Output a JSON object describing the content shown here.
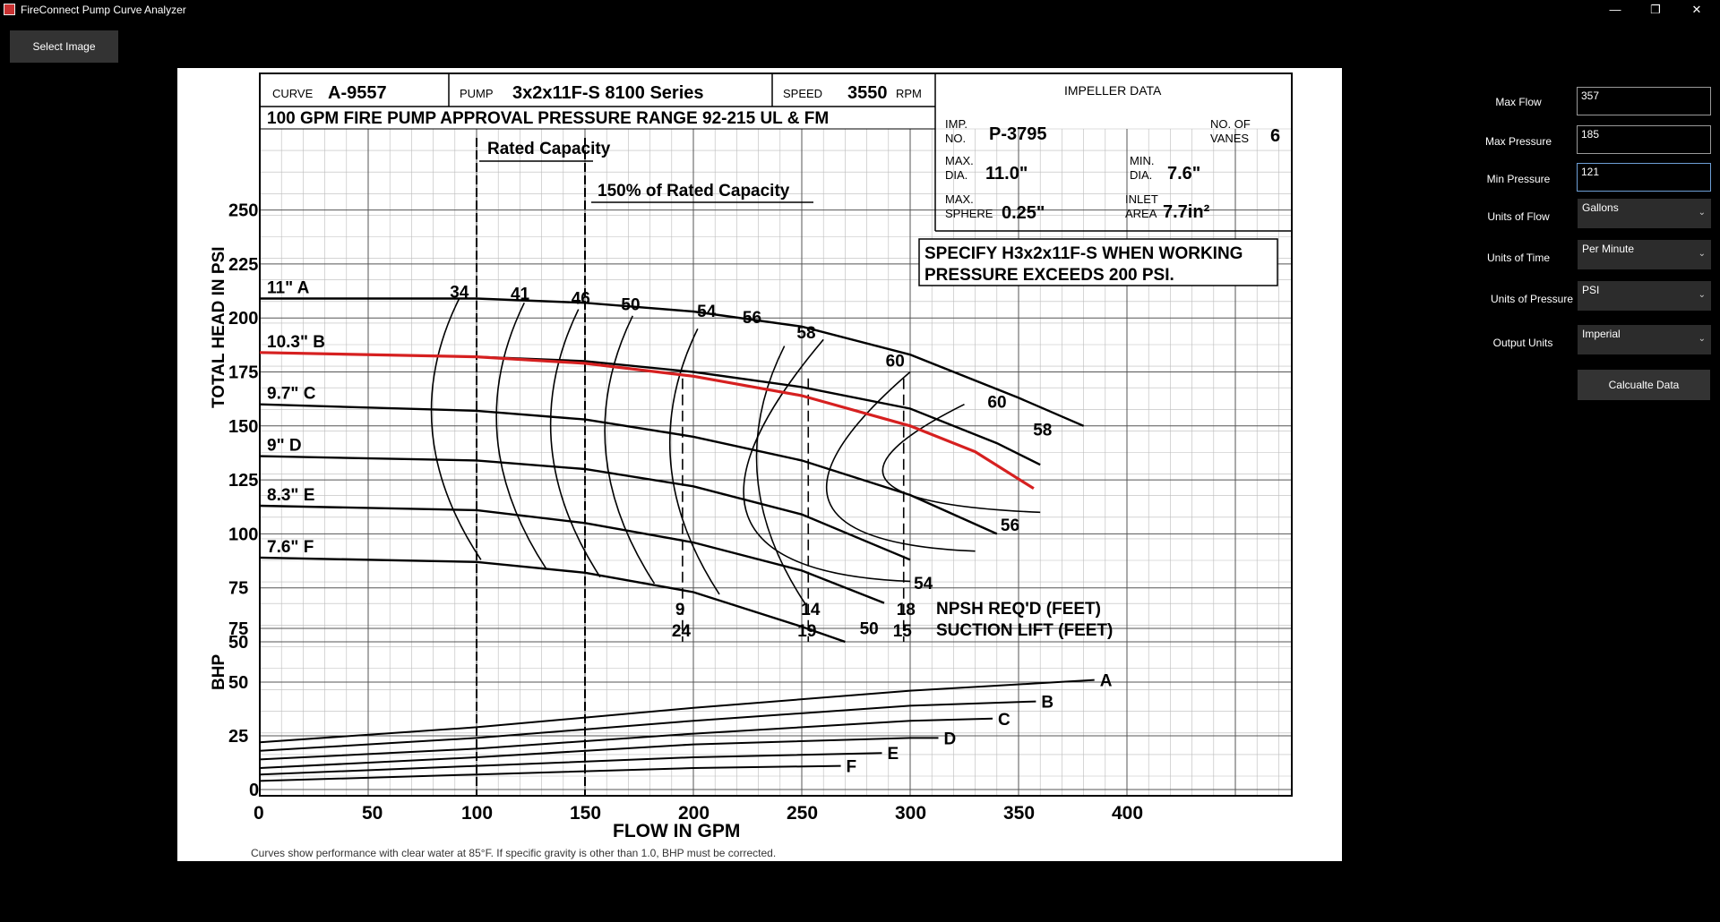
{
  "window": {
    "title": "FireConnect Pump Curve Analyzer",
    "minimize_glyph": "—",
    "restore_glyph": "❐",
    "close_glyph": "✕"
  },
  "toolbar": {
    "select_image_label": "Select Image"
  },
  "sidebar": {
    "max_flow": {
      "label": "Max Flow",
      "value": "357"
    },
    "max_pressure": {
      "label": "Max Pressure",
      "value": "185"
    },
    "min_pressure": {
      "label": "Min Pressure",
      "value": "121"
    },
    "units_of_flow": {
      "label": "Units of Flow",
      "value": "Gallons"
    },
    "units_of_time": {
      "label": "Units of Time",
      "value": "Per Minute"
    },
    "units_of_pressure": {
      "label": "Units of Pressure",
      "value": "PSI"
    },
    "output_units": {
      "label": "Output Units",
      "value": "Imperial"
    },
    "calculate_label": "Calcualte Data"
  },
  "curve_sheet": {
    "curve_label": "CURVE",
    "curve_id": "A-9557",
    "pump_label": "PUMP",
    "pump_model": "3x2x11F-S  8100 Series",
    "speed_label": "SPEED",
    "speed_value": "3550",
    "speed_unit": "RPM",
    "approval_line": "100 GPM FIRE PUMP APPROVAL PRESSURE RANGE 92-215 UL & FM",
    "impeller_header": "IMPELLER DATA",
    "imp_no_label_1": "IMP.",
    "imp_no_label_2": "NO.",
    "imp_no": "P-3795",
    "vanes_label_1": "NO. OF",
    "vanes_label_2": "VANES",
    "vanes": "6",
    "max_dia_label_1": "MAX.",
    "max_dia_label_2": "DIA.",
    "max_dia": "11.0\"",
    "min_dia_label_1": "MIN.",
    "min_dia_label_2": "DIA.",
    "min_dia": "7.6\"",
    "max_sphere_label_1": "MAX.",
    "max_sphere_label_2": "SPHERE",
    "max_sphere": "0.25\"",
    "inlet_label_1": "INLET",
    "inlet_label_2": "AREA",
    "inlet_area": "7.7in²",
    "specify_line_1": "SPECIFY H3x2x11F-S WHEN WORKING",
    "specify_line_2": "PRESSURE EXCEEDS 200 PSI.",
    "rated_capacity": "Rated Capacity",
    "rated_150": "150% of Rated Capacity",
    "npsh_label": "NPSH REQ'D (FEET)",
    "suction_label": "SUCTION LIFT (FEET)",
    "y_head_label": "TOTAL HEAD IN PSI",
    "y_bhp_label": "BHP",
    "x_label": "FLOW IN GPM",
    "footnote": "Curves show performance with clear water at 85°F. If specific gravity is other than 1.0, BHP must be corrected."
  },
  "chart_data": {
    "type": "line",
    "x_axis": {
      "label": "FLOW IN GPM",
      "range": [
        0,
        475
      ],
      "ticks": [
        0,
        50,
        100,
        150,
        200,
        250,
        300,
        350,
        400
      ]
    },
    "y_head_axis": {
      "label": "TOTAL HEAD IN PSI",
      "range": [
        45,
        250
      ],
      "ticks": [
        50,
        75,
        100,
        125,
        150,
        175,
        200,
        225,
        250
      ]
    },
    "y_bhp_axis": {
      "label": "BHP",
      "range": [
        0,
        75
      ],
      "ticks": [
        0,
        25,
        50,
        75
      ]
    },
    "head_curves": [
      {
        "name": "11\" A",
        "points": [
          [
            0,
            209
          ],
          [
            100,
            209
          ],
          [
            150,
            207
          ],
          [
            200,
            203
          ],
          [
            250,
            196
          ],
          [
            300,
            183
          ],
          [
            350,
            163
          ],
          [
            380,
            150
          ]
        ]
      },
      {
        "name": "10.3\" B",
        "points": [
          [
            0,
            184
          ],
          [
            100,
            182
          ],
          [
            150,
            180
          ],
          [
            200,
            175
          ],
          [
            250,
            168
          ],
          [
            300,
            158
          ],
          [
            340,
            142
          ],
          [
            360,
            132
          ]
        ]
      },
      {
        "name": "9.7\" C",
        "points": [
          [
            0,
            160
          ],
          [
            100,
            157
          ],
          [
            150,
            153
          ],
          [
            200,
            145
          ],
          [
            250,
            134
          ],
          [
            300,
            118
          ],
          [
            340,
            100
          ]
        ]
      },
      {
        "name": "9\" D",
        "points": [
          [
            0,
            136
          ],
          [
            100,
            134
          ],
          [
            150,
            130
          ],
          [
            200,
            122
          ],
          [
            250,
            109
          ],
          [
            300,
            88
          ]
        ]
      },
      {
        "name": "8.3\" E",
        "points": [
          [
            0,
            113
          ],
          [
            100,
            111
          ],
          [
            150,
            105
          ],
          [
            200,
            96
          ],
          [
            250,
            83
          ],
          [
            288,
            68
          ]
        ]
      },
      {
        "name": "7.6\" F",
        "points": [
          [
            0,
            89
          ],
          [
            100,
            87
          ],
          [
            150,
            82
          ],
          [
            200,
            73
          ],
          [
            250,
            57
          ],
          [
            270,
            50
          ]
        ]
      }
    ],
    "selected_curve": {
      "points": [
        [
          0,
          184
        ],
        [
          100,
          182
        ],
        [
          150,
          179
        ],
        [
          200,
          173
        ],
        [
          250,
          164
        ],
        [
          300,
          150
        ],
        [
          330,
          138
        ],
        [
          357,
          121
        ]
      ]
    },
    "efficiency_labels": [
      "34",
      "41",
      "46",
      "50",
      "54",
      "56",
      "58",
      "60",
      "60",
      "58",
      "56",
      "54",
      "50"
    ],
    "npsh_lines": [
      {
        "flow": 195,
        "npsh": "9",
        "suction": "24"
      },
      {
        "flow": 253,
        "npsh": "14",
        "suction": "19"
      },
      {
        "flow": 297,
        "npsh": "18",
        "suction": "15"
      }
    ],
    "rated_lines": [
      100,
      150
    ],
    "bhp_curves": [
      {
        "name": "A",
        "points": [
          [
            0,
            22
          ],
          [
            100,
            29
          ],
          [
            200,
            38
          ],
          [
            300,
            46
          ],
          [
            385,
            51
          ]
        ]
      },
      {
        "name": "B",
        "points": [
          [
            0,
            18
          ],
          [
            100,
            24
          ],
          [
            200,
            32
          ],
          [
            300,
            39
          ],
          [
            358,
            41
          ]
        ]
      },
      {
        "name": "C",
        "points": [
          [
            0,
            14
          ],
          [
            100,
            19
          ],
          [
            200,
            26
          ],
          [
            300,
            32
          ],
          [
            338,
            33
          ]
        ]
      },
      {
        "name": "D",
        "points": [
          [
            0,
            10
          ],
          [
            100,
            15
          ],
          [
            200,
            21
          ],
          [
            300,
            24
          ],
          [
            313,
            24
          ]
        ]
      },
      {
        "name": "E",
        "points": [
          [
            0,
            7
          ],
          [
            100,
            11
          ],
          [
            200,
            15
          ],
          [
            287,
            17
          ]
        ]
      },
      {
        "name": "F",
        "points": [
          [
            0,
            4
          ],
          [
            100,
            7
          ],
          [
            200,
            10
          ],
          [
            268,
            11
          ]
        ]
      }
    ]
  }
}
